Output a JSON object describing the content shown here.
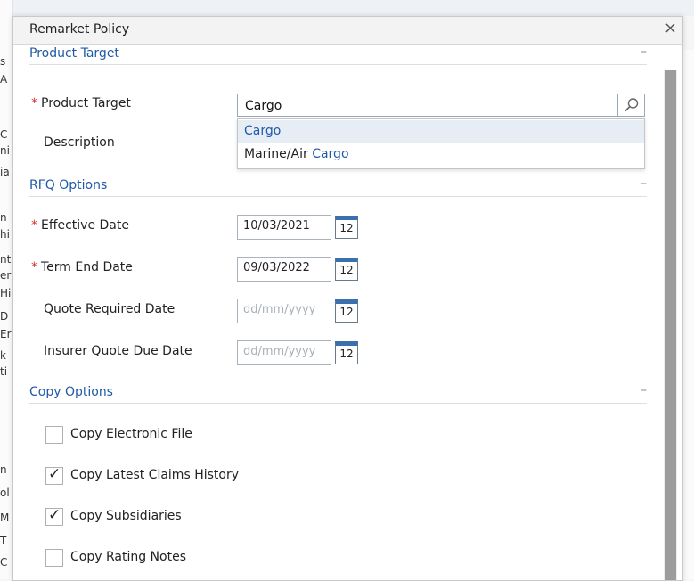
{
  "background_fragments": [
    "s",
    "A",
    "C",
    "ni",
    "ia",
    "n",
    "hi",
    "nt",
    "er",
    "Hi",
    "D",
    "Er",
    "k",
    "ti",
    "n",
    "ol",
    "M",
    "T",
    "C"
  ],
  "dialog": {
    "title": "Remarket Policy",
    "close_glyph": "×"
  },
  "sections": {
    "product_target": {
      "title": "Product Target",
      "collapse_glyph": "–",
      "product_target_label": "Product Target",
      "product_target_value": "Cargo",
      "description_label": "Description",
      "dropdown": [
        {
          "prefix": "",
          "match": "Cargo",
          "selected": true
        },
        {
          "prefix": "Marine/Air ",
          "match": "Cargo",
          "selected": false
        }
      ]
    },
    "rfq_options": {
      "title": "RFQ Options",
      "collapse_glyph": "–",
      "calendar_glyph": "12",
      "fields": [
        {
          "label": "Effective Date",
          "required": true,
          "value": "10/03/2021",
          "placeholder": ""
        },
        {
          "label": "Term End Date",
          "required": true,
          "value": "09/03/2022",
          "placeholder": ""
        },
        {
          "label": "Quote Required Date",
          "required": false,
          "value": "",
          "placeholder": "dd/mm/yyyy"
        },
        {
          "label": "Insurer Quote Due Date",
          "required": false,
          "value": "",
          "placeholder": "dd/mm/yyyy"
        }
      ]
    },
    "copy_options": {
      "title": "Copy Options",
      "collapse_glyph": "–",
      "items": [
        {
          "label": "Copy Electronic File",
          "checked": false
        },
        {
          "label": "Copy Latest Claims History",
          "checked": true
        },
        {
          "label": "Copy Subsidiaries",
          "checked": true
        },
        {
          "label": "Copy Rating Notes",
          "checked": false
        }
      ]
    }
  },
  "required_marker": "*",
  "check_glyph": "✓",
  "colors": {
    "accent": "#1f5aa6",
    "required": "#d9342b",
    "scroll_thumb": "#9c9c9c"
  }
}
